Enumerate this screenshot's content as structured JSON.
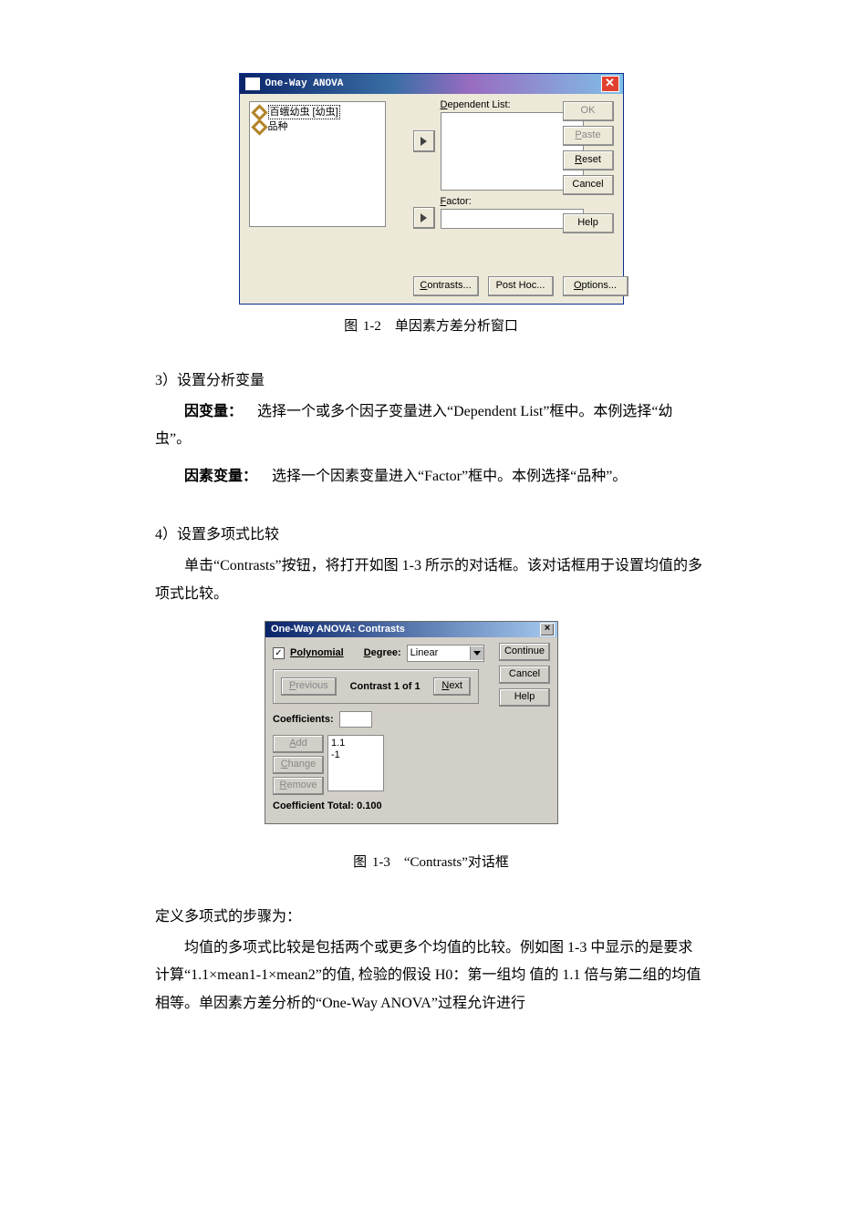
{
  "figure_1_2": {
    "title": "One-Way ANOVA",
    "var_items": [
      "百蛾幼虫 [幼虫]",
      "品种"
    ],
    "dependent_label": "Dependent List:",
    "factor_label": "Factor:",
    "buttons": {
      "ok": "OK",
      "paste": "Paste",
      "reset": "Reset",
      "cancel": "Cancel",
      "help": "Help"
    },
    "bottom_buttons": {
      "contrasts": "Contrasts...",
      "posthoc": "Post Hoc...",
      "options": "Options..."
    },
    "caption": "图 1-2 单因素方差分析窗口"
  },
  "text": {
    "s3_head": "3）设置分析变量",
    "s3_p1_bold": "因变量：",
    "s3_p1_rest": " 选择一个或多个因子变量进入“Dependent List”框中。本例选择“幼虫”。",
    "s3_p2_bold": "因素变量：",
    "s3_p2_rest": " 选择一个因素变量进入“Factor”框中。本例选择“品种”。",
    "s4_head": "4）设置多项式比较",
    "s4_p1": "单击“Contrasts”按钮，将打开如图 1-3 所示的对话框。该对话框用于设置均值的多项式比较。",
    "fig13_caption": "图 1-3 “Contrasts”对话框",
    "p_after_head": "定义多项式的步骤为：",
    "p_after1": "均值的多项式比较是包括两个或更多个均值的比较。例如图 1-3 中显示的是要求计算“1.1×mean1-1×mean2”的值, 检验的假设 H0：第一组均 值的 1.1 倍与第二组的均值相等。单因素方差分析的“One-Way ANOVA”过程允许进行"
  },
  "figure_1_3": {
    "title": "One-Way ANOVA: Contrasts",
    "polynomial_label": "Polynomial",
    "degree_label": "Degree:",
    "degree_value": "Linear",
    "prev_label": "Previous",
    "contrast_label": "Contrast 1 of 1",
    "next_label": "Next",
    "coef_label": "Coefficients:",
    "add_label": "Add",
    "change_label": "Change",
    "remove_label": "Remove",
    "coef_values": "1.1\n-1",
    "total_label": "Coefficient Total: 0.100",
    "side": {
      "continue": "Continue",
      "cancel": "Cancel",
      "help": "Help"
    }
  }
}
